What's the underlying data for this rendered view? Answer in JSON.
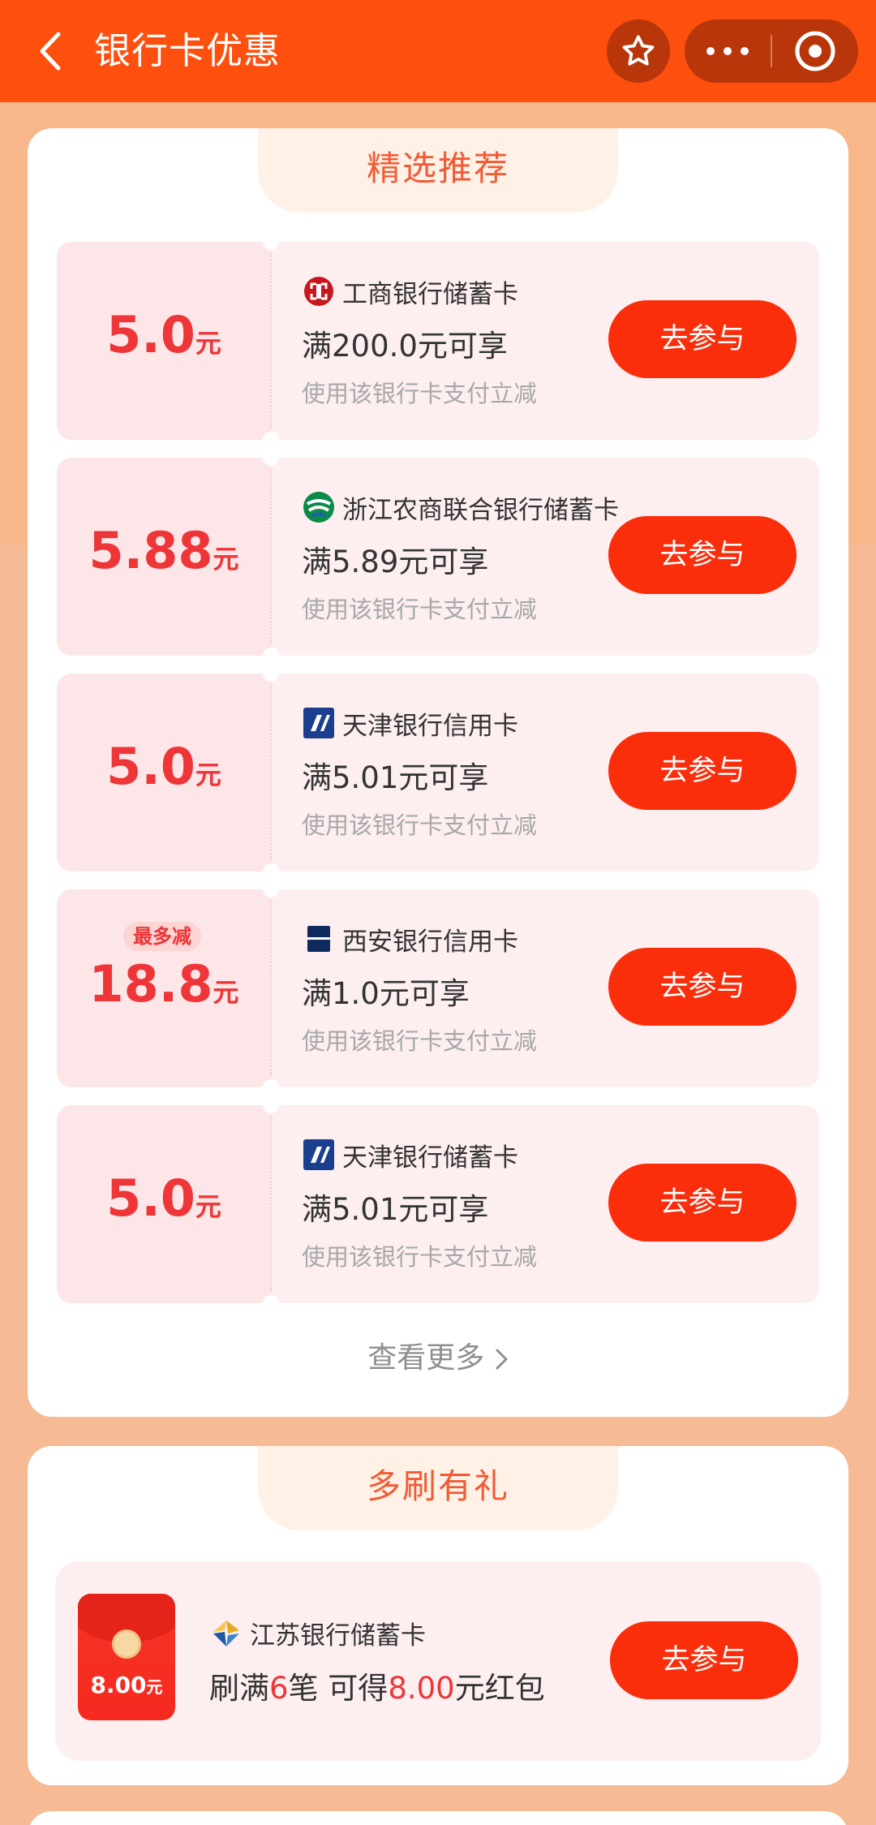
{
  "header": {
    "title": "银行卡优惠"
  },
  "featured": {
    "title": "精选推荐",
    "cards": [
      {
        "amount": "5.0",
        "unit": "元",
        "badge": "",
        "bank": "工商银行储蓄卡",
        "logo": "icbc-logo",
        "condition": "满200.0元可享",
        "note": "使用该银行卡支付立减",
        "button": "去参与"
      },
      {
        "amount": "5.88",
        "unit": "元",
        "badge": "",
        "bank": "浙江农商联合银行储蓄卡",
        "logo": "zhejiang-rural-bank-logo",
        "condition": "满5.89元可享",
        "note": "使用该银行卡支付立减",
        "button": "去参与"
      },
      {
        "amount": "5.0",
        "unit": "元",
        "badge": "",
        "bank": "天津银行信用卡",
        "logo": "bank-of-tianjin-logo",
        "condition": "满5.01元可享",
        "note": "使用该银行卡支付立减",
        "button": "去参与"
      },
      {
        "amount": "18.8",
        "unit": "元",
        "badge": "最多减",
        "bank": "西安银行信用卡",
        "logo": "bank-of-xian-logo",
        "condition": "满1.0元可享",
        "note": "使用该银行卡支付立减",
        "button": "去参与"
      },
      {
        "amount": "5.0",
        "unit": "元",
        "badge": "",
        "bank": "天津银行储蓄卡",
        "logo": "bank-of-tianjin-logo",
        "condition": "满5.01元可享",
        "note": "使用该银行卡支付立减",
        "button": "去参与"
      }
    ],
    "see_more": "查看更多"
  },
  "multi_swipe": {
    "title": "多刷有礼",
    "card": {
      "packet_amount": "8.00",
      "packet_unit": "元",
      "bank": "江苏银行储蓄卡",
      "cond_prefix": "刷满",
      "cond_count": "6",
      "cond_mid": "笔 可得",
      "cond_amount": "8.00",
      "cond_suffix": "元红包",
      "button": "去参与"
    }
  },
  "colors": {
    "header_bg": "#fd4f0e",
    "accent_red": "#ee3538",
    "button_red": "#fb2e0c"
  }
}
